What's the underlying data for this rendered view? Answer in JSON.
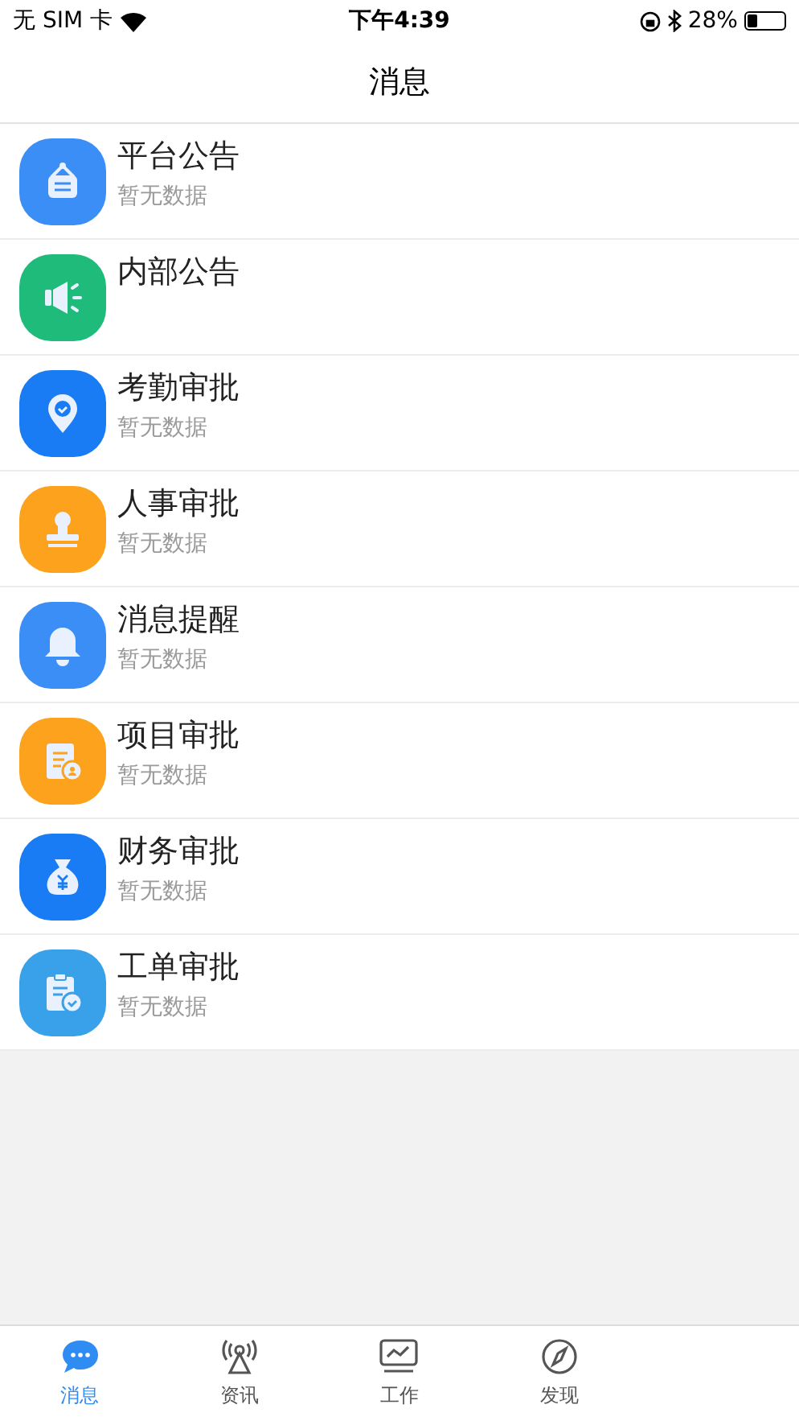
{
  "status_bar": {
    "carrier": "无 SIM 卡",
    "time": "下午4:39",
    "battery": {
      "text": "28%",
      "level": 0.28
    }
  },
  "title": "消息",
  "items": [
    {
      "kind": "notice",
      "color": "#3a8ef6",
      "title": "平台公告",
      "subtitle": "暂无数据"
    },
    {
      "kind": "speaker",
      "color": "#1fbb7a",
      "title": "内部公告"
    },
    {
      "kind": "location",
      "color": "#1a7cf5",
      "title": "考勤审批",
      "subtitle": "暂无数据"
    },
    {
      "kind": "stamp",
      "color": "#fca21c",
      "title": "人事审批",
      "subtitle": "暂无数据"
    },
    {
      "kind": "bell",
      "color": "#3a8ef6",
      "title": "消息提醒",
      "subtitle": "暂无数据"
    },
    {
      "kind": "document",
      "color": "#fca21c",
      "title": "项目审批",
      "subtitle": "暂无数据"
    },
    {
      "kind": "moneybag",
      "color": "#1a7cf5",
      "title": "财务审批",
      "subtitle": "暂无数据"
    },
    {
      "kind": "clipboard",
      "color": "#39a0ea",
      "title": "工单审批",
      "subtitle": "暂无数据"
    }
  ],
  "tabs": [
    {
      "kind": "chat",
      "label": "消息",
      "selected": true
    },
    {
      "kind": "antenna",
      "label": "资讯",
      "selected": false
    },
    {
      "kind": "chart",
      "label": "工作",
      "selected": false
    },
    {
      "kind": "compass",
      "label": "发现",
      "selected": false
    }
  ]
}
